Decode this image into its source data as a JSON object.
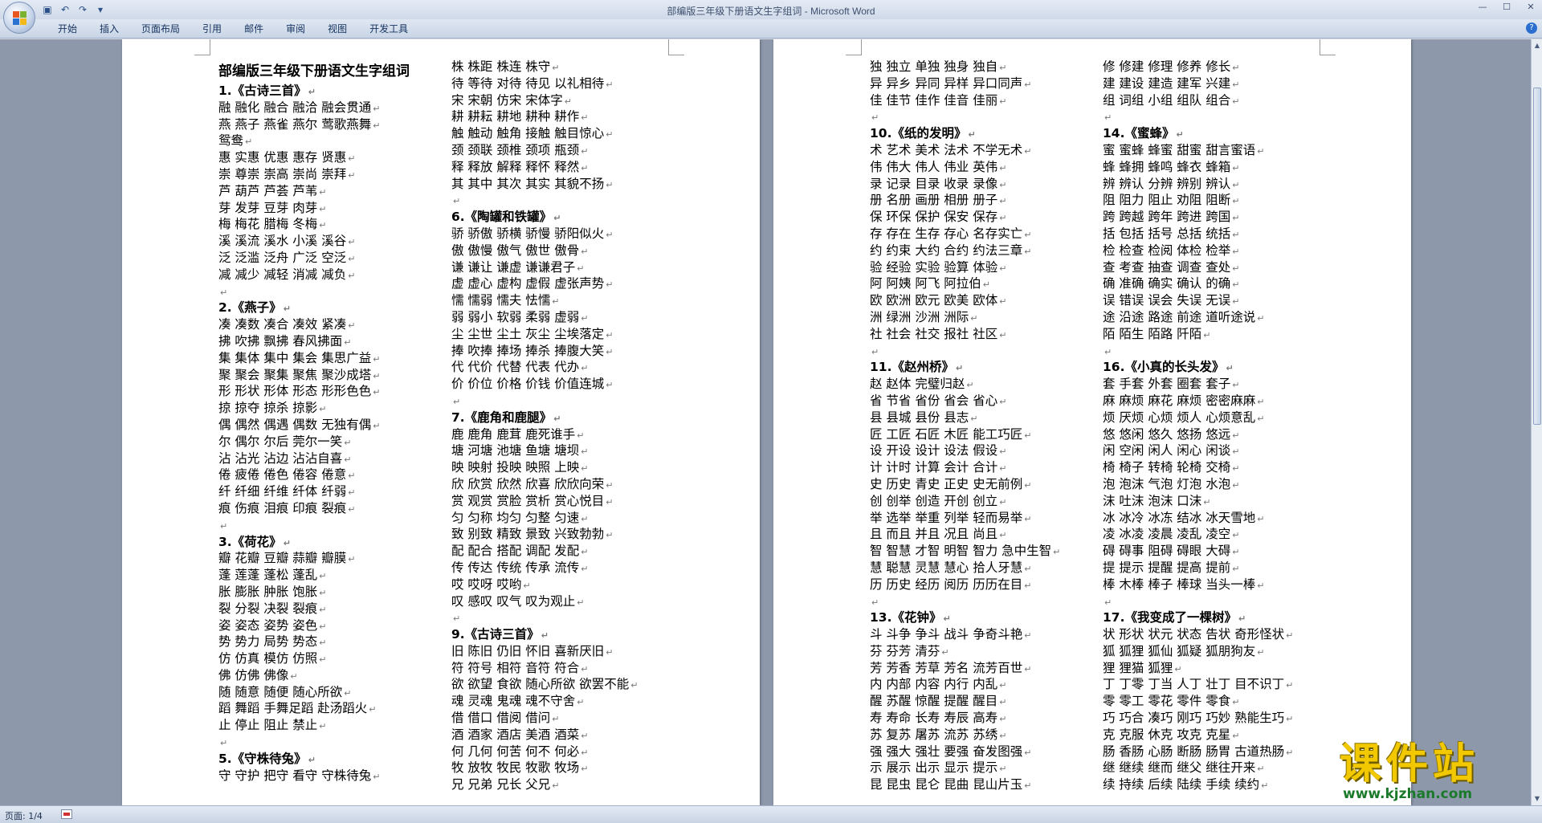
{
  "window": {
    "title": "部编版三年级下册语文生字组词 - Microsoft Word",
    "controls": [
      "minimize",
      "maximize",
      "close"
    ]
  },
  "quick_access": [
    {
      "name": "save-icon",
      "glyph": "▣"
    },
    {
      "name": "undo-icon",
      "glyph": "↶"
    },
    {
      "name": "redo-icon",
      "glyph": "↷"
    },
    {
      "name": "customize-icon",
      "glyph": "▾"
    }
  ],
  "ribbon": {
    "tabs": [
      "开始",
      "插入",
      "页面布局",
      "引用",
      "邮件",
      "审阅",
      "视图",
      "开发工具"
    ]
  },
  "document": {
    "title": "部编版三年级下册语文生字组词",
    "page1_col1": [
      "1.《古诗三首》",
      "融 融化 融合 融洽 融会贯通",
      "燕 燕子 燕雀 燕尔 莺歌燕舞",
      "鸳鸯",
      "惠 实惠 优惠 惠存 贤惠",
      "崇 尊崇 崇高 崇尚 崇拜",
      "芦 葫芦 芦荟 芦苇",
      "芽 发芽 豆芽 肉芽",
      "梅 梅花 腊梅 冬梅",
      "溪 溪流 溪水 小溪 溪谷",
      "泛 泛滥 泛舟 广泛 空泛",
      "减 减少 减轻 消减 减负",
      "",
      "2.《燕子》",
      "凑 凑数 凑合 凑效 紧凑",
      "拂 吹拂 飘拂 春风拂面",
      "集 集体 集中 集会 集思广益",
      "聚 聚会 聚集 聚焦 聚沙成塔",
      "形 形状 形体 形态 形形色色",
      "掠 掠夺 掠杀 掠影",
      "偶 偶然 偶遇 偶数 无独有偶",
      "尔 偶尔 尔后 莞尔一笑",
      "沾 沾光 沾边 沾沾自喜",
      "倦 疲倦 倦色 倦容 倦意",
      "纤 纤细 纤维 纤体 纤弱",
      "痕 伤痕 泪痕 印痕 裂痕",
      "",
      "3.《荷花》",
      "瓣 花瓣 豆瓣 蒜瓣 瓣膜",
      "蓬 莲蓬 蓬松 蓬乱",
      "胀 膨胀 肿胀 饱胀",
      "裂 分裂 决裂 裂痕",
      "姿 姿态 姿势 姿色",
      "势 势力 局势 势态",
      "仿 仿真 模仿 仿照",
      "佛 仿佛 佛像",
      "随 随意 随便 随心所欲",
      "蹈 舞蹈 手舞足蹈 赴汤蹈火",
      "止 停止 阻止 禁止",
      "",
      "5.《守株待兔》",
      "守 守护 把守 看守 守株待兔"
    ],
    "page1_col2": [
      "株 株距 株连 株守",
      "待 等待 对待 待见 以礼相待",
      "宋 宋朝 仿宋 宋体字",
      "耕 耕耘 耕地 耕种 耕作",
      "触 触动 触角 接触 触目惊心",
      "颈 颈联 颈椎 颈项 瓶颈",
      "释 释放 解释 释怀 释然",
      "其 其中 其次 其实 其貌不扬",
      "",
      "6.《陶罐和铁罐》",
      "骄 骄傲 骄横 骄慢 骄阳似火",
      "傲 傲慢 傲气 傲世 傲骨",
      "谦 谦让 谦虚 谦谦君子",
      "虚 虚心 虚构 虚假 虚张声势",
      "懦 懦弱 懦夫 怯懦",
      "弱 弱小 软弱 柔弱 虚弱",
      "尘 尘世 尘土 灰尘 尘埃落定",
      "捧 吹捧 捧场 捧杀 捧腹大笑",
      "代 代价 代替 代表 代办",
      "价 价位 价格 价钱 价值连城",
      "",
      "7.《鹿角和鹿腿》",
      "鹿 鹿角 鹿茸 鹿死谁手",
      "塘 河塘 池塘 鱼塘 塘坝",
      "映 映射 投映 映照 上映",
      "欣 欣赏 欣然 欣喜 欣欣向荣",
      "赏 观赏 赏脸 赏析 赏心悦目",
      "匀 匀称 均匀 匀整 匀速",
      "致 别致 精致 景致 兴致勃勃",
      "配 配合 搭配 调配 发配",
      "传 传达 传统 传承 流传",
      "哎 哎呀 哎哟",
      "叹 感叹 叹气 叹为观止",
      "",
      "9.《古诗三首》",
      "旧 陈旧 仍旧 怀旧 喜新厌旧",
      "符 符号 相符 音符 符合",
      "欲 欲望 食欲 随心所欲 欲罢不能",
      "魂 灵魂 鬼魂 魂不守舍",
      "借 借口 借阅 借问",
      "酒 酒家 酒店 美酒 酒菜",
      "何 几何 何苦 何不 何必",
      "牧 放牧 牧民 牧歌 牧场",
      "兄 兄弟 兄长 父兄"
    ],
    "page2_col1": [
      "独 独立 单独 独身 独自",
      "异 异乡 异同 异样 异口同声",
      "佳 佳节 佳作 佳音 佳丽",
      "",
      "10.《纸的发明》",
      "术 艺术 美术 法术 不学无术",
      "伟 伟大 伟人 伟业 英伟",
      "录 记录 目录 收录 录像",
      "册 名册 画册 相册 册子",
      "保 环保 保护 保安 保存",
      "存 存在 生存 存心 名存实亡",
      "约 约束 大约 合约 约法三章",
      "验 经验 实验 验算 体验",
      "阿 阿姨 阿飞 阿拉伯",
      "欧 欧洲 欧元 欧美 欧体",
      "洲 绿洲 沙洲 洲际",
      "社 社会 社交 报社 社区",
      "",
      "11.《赵州桥》",
      "赵 赵体 完璧归赵",
      "省 节省 省份 省会 省心",
      "县 县城 县份 县志",
      "匠 工匠 石匠 木匠 能工巧匠",
      "设 开设 设计 设法 假设",
      "计 计时 计算 会计 合计",
      "史 历史 青史 正史 史无前例",
      "创 创举 创造 开创 创立",
      "举 选举 举重 列举 轻而易举",
      "且 而且 并且 况且 尚且",
      "智 智慧 才智 明智 智力 急中生智",
      "慧 聪慧 灵慧 慧心 拾人牙慧",
      "历 历史 经历 阅历 历历在目",
      "",
      "13.《花钟》",
      "斗 斗争 争斗 战斗 争奇斗艳",
      "芬 芬芳 清芬",
      "芳 芳香 芳草 芳名 流芳百世",
      "内 内部 内容 内行 内乱",
      "醒 苏醒 惊醒 提醒 醒目",
      "寿 寿命 长寿 寿辰 高寿",
      "苏 复苏 屠苏 流苏 苏绣",
      "强 强大 强壮 要强 奋发图强",
      "示 展示 出示 显示 提示",
      "昆 昆虫 昆仑 昆曲 昆山片玉"
    ],
    "page2_col2": [
      "修 修建 修理 修养 修长",
      "建 建设 建造 建军 兴建",
      "组 词组 小组 组队 组合",
      "",
      "14.《蜜蜂》",
      "蜜 蜜蜂 蜂蜜 甜蜜 甜言蜜语",
      "蜂 蜂拥 蜂鸣 蜂衣 蜂箱",
      "辨 辨认 分辨 辨别 辨认",
      "阻 阻力 阻止 劝阻 阻断",
      "跨 跨越 跨年 跨进 跨国",
      "括 包括 括号 总括 统括",
      "检 检查 检阅 体检 检举",
      "查 考查 抽查 调查 查处",
      "确 准确 确实 确认 的确",
      "误 错误 误会 失误 无误",
      "途 沿途 路途 前途 道听途说",
      "陌 陌生 陌路 阡陌",
      "",
      "16.《小真的长头发》",
      "套 手套 外套 圈套 套子",
      "麻 麻烦 麻花 麻烦 密密麻麻",
      "烦 厌烦 心烦 烦人 心烦意乱",
      "悠 悠闲 悠久 悠扬 悠远",
      "闲 空闲 闲人 闲心 闲谈",
      "椅 椅子 转椅 轮椅 交椅",
      "泡 泡沫 气泡 灯泡 水泡",
      "沫 吐沫 泡沫 口沫",
      "冰 冰冷 冰冻 结冰 冰天雪地",
      "凌 冰凌 凌晨 凌乱 凌空",
      "碍 碍事 阻碍 碍眼 大碍",
      "提 提示 提醒 提高 提前",
      "棒 木棒 棒子 棒球 当头一棒",
      "",
      "17.《我变成了一棵树》",
      "状 形状 状元 状态 告状 奇形怪状",
      "狐 狐狸 狐仙 狐疑 狐朋狗友",
      "狸 狸猫 狐狸",
      "丁 丁零 丁当 人丁 壮丁 目不识丁",
      "零 零工 零花 零件 零食",
      "巧 巧合 凑巧 刚巧 巧妙 熟能生巧",
      "克 克服 休克 攻克 克星",
      "肠 香肠 心肠 断肠 肠胃 古道热肠",
      "继 继续 继而 继父 继往开来",
      "续 持续 后续 陆续 手续 续约"
    ]
  },
  "statusbar": {
    "page": "页面: 1/4"
  },
  "watermark": {
    "text": "课件站",
    "url": "www.kjzhan.com"
  }
}
